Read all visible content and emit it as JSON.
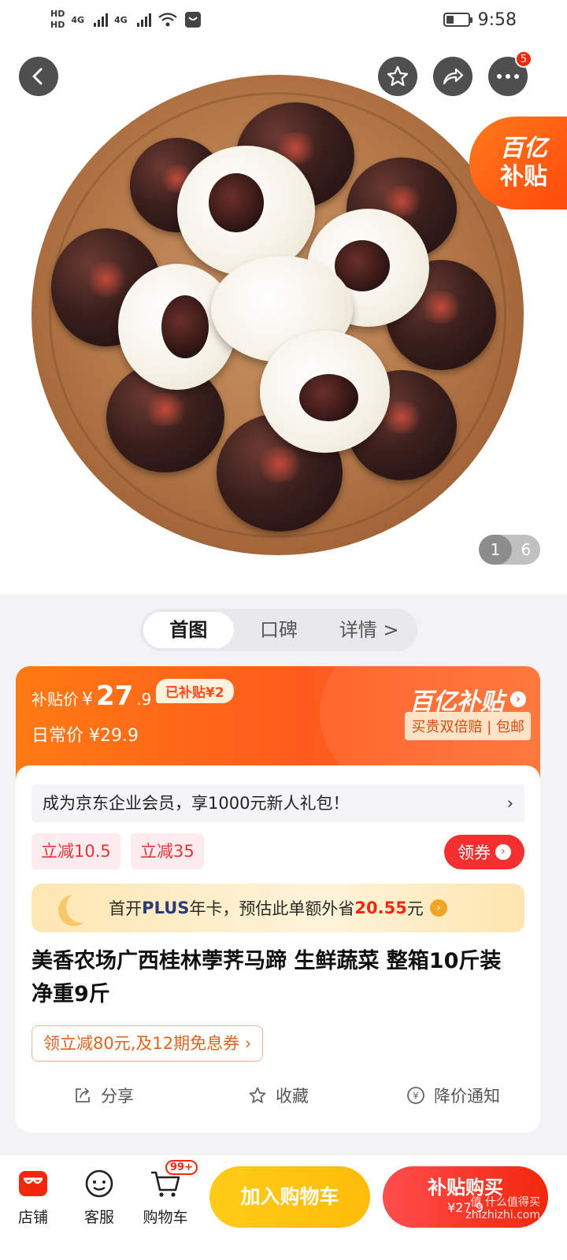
{
  "status_bar": {
    "time": "9:58",
    "network_1": "4G",
    "network_2": "4G",
    "hd_1": "HD",
    "hd_2": "HD"
  },
  "hero": {
    "more_badge": "5",
    "subsidy_tag": {
      "line1": "百亿",
      "line2": "补贴"
    },
    "pager": {
      "current": "1",
      "total": "6"
    }
  },
  "tabs": [
    {
      "label": "首图",
      "active": true
    },
    {
      "label": "口碑",
      "active": false
    },
    {
      "label": "详情 >",
      "active": false
    }
  ],
  "price": {
    "subsidy_label": "补贴价",
    "currency": "¥",
    "subsidy_int": "27",
    "subsidy_dec": ".9",
    "saved_tag": "已补贴¥2",
    "regular_label": "日常价",
    "regular_price": "¥29.9",
    "brand": "百亿补贴",
    "guarantee": "买贵双倍赔 | 包邮"
  },
  "member_bar": {
    "text": "成为京东企业会员，享1000元新人礼包！",
    "chevron": "›"
  },
  "coupons": [
    "立减10.5",
    "立减35"
  ],
  "claim_button": "领券",
  "plus_bar": {
    "prefix": "首开",
    "plus": "PLUS",
    "mid": "年卡，预估此单额外省",
    "amount": "20.55",
    "unit": "元"
  },
  "product_title": "美香农场广西桂林荸荠马蹄 生鲜蔬菜 整箱10斤装 净重9斤",
  "promo_link": "领立减80元,及12期免息券 ›",
  "actions": {
    "share": "分享",
    "favorite": "收藏",
    "price_alert": "降价通知"
  },
  "bottom_bar": {
    "store": "店铺",
    "service": "客服",
    "cart": "购物车",
    "cart_badge": "99+",
    "add_to_cart": "加入购物车",
    "buy_now_line1": "补贴购买",
    "buy_now_line2": "¥27.9",
    "watermark_line1": "值 什么值得买",
    "watermark_line2": "zhizhizhi.com"
  },
  "colors": {
    "accent": "#ff5a1c",
    "red": "#f2270c",
    "yellow": "#ffcc18"
  }
}
